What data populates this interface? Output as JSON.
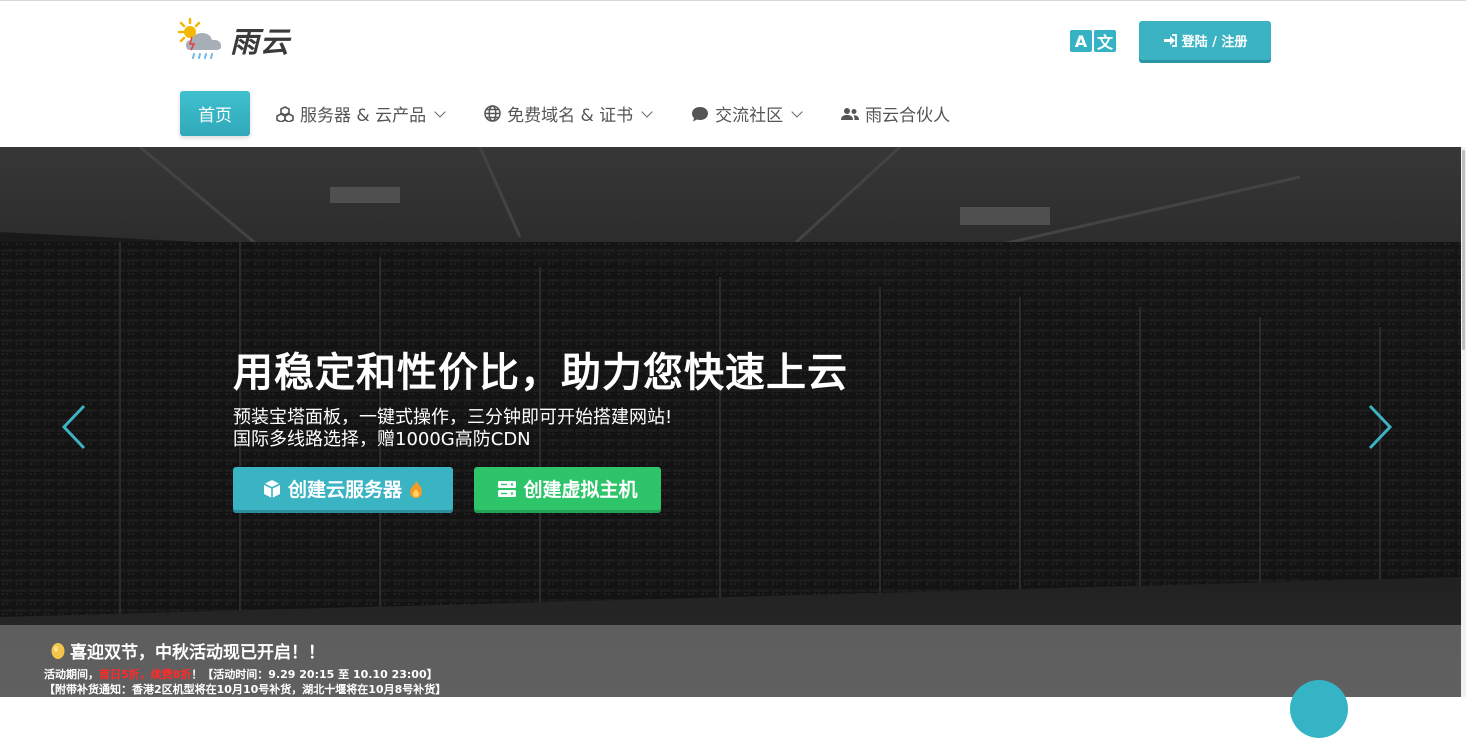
{
  "brand": {
    "name": "雨云",
    "logo_icon": "sun-cloud-rain-icon"
  },
  "header": {
    "lang_toggle": {
      "left": "A",
      "right": "文",
      "icon": "translate-icon"
    },
    "login_label": "登陆 / 注册",
    "login_icon": "sign-in-icon"
  },
  "nav": {
    "items": [
      {
        "label": "首页",
        "active": true
      },
      {
        "label": "服务器 & 云产品",
        "icon": "cubes-icon",
        "dropdown": true
      },
      {
        "label": "免费域名 & 证书",
        "icon": "globe-icon",
        "dropdown": true
      },
      {
        "label": "交流社区",
        "icon": "comment-icon",
        "dropdown": true
      },
      {
        "label": "雨云合伙人",
        "icon": "users-icon",
        "dropdown": false
      }
    ]
  },
  "hero": {
    "title": "用稳定和性价比，助力您快速上云",
    "subtitle_1": "预装宝塔面板，一键式操作，三分钟即可开始搭建网站!",
    "subtitle_2": "国际多线路选择，赠1000G高防CDN",
    "btn_cloud": "创建云服务器",
    "btn_host": "创建虚拟主机"
  },
  "notice": {
    "title": "喜迎双节，中秋活动现已开启！！",
    "line1_prefix": "活动期间，",
    "line1_red_1": "首日5折",
    "line1_sep": "，",
    "line1_red_2": "续费8折",
    "line1_suffix": "！【活动时间：9.29 20:15 至 10.10 23:00】",
    "line2": "【附带补货通知：香港2区机型将在10月10号补货，湖北十堰将在10月8号补货】"
  },
  "colors": {
    "primary": "#3cb3c2",
    "success": "#2ec56a",
    "highlight_red": "#ff2a2a"
  }
}
